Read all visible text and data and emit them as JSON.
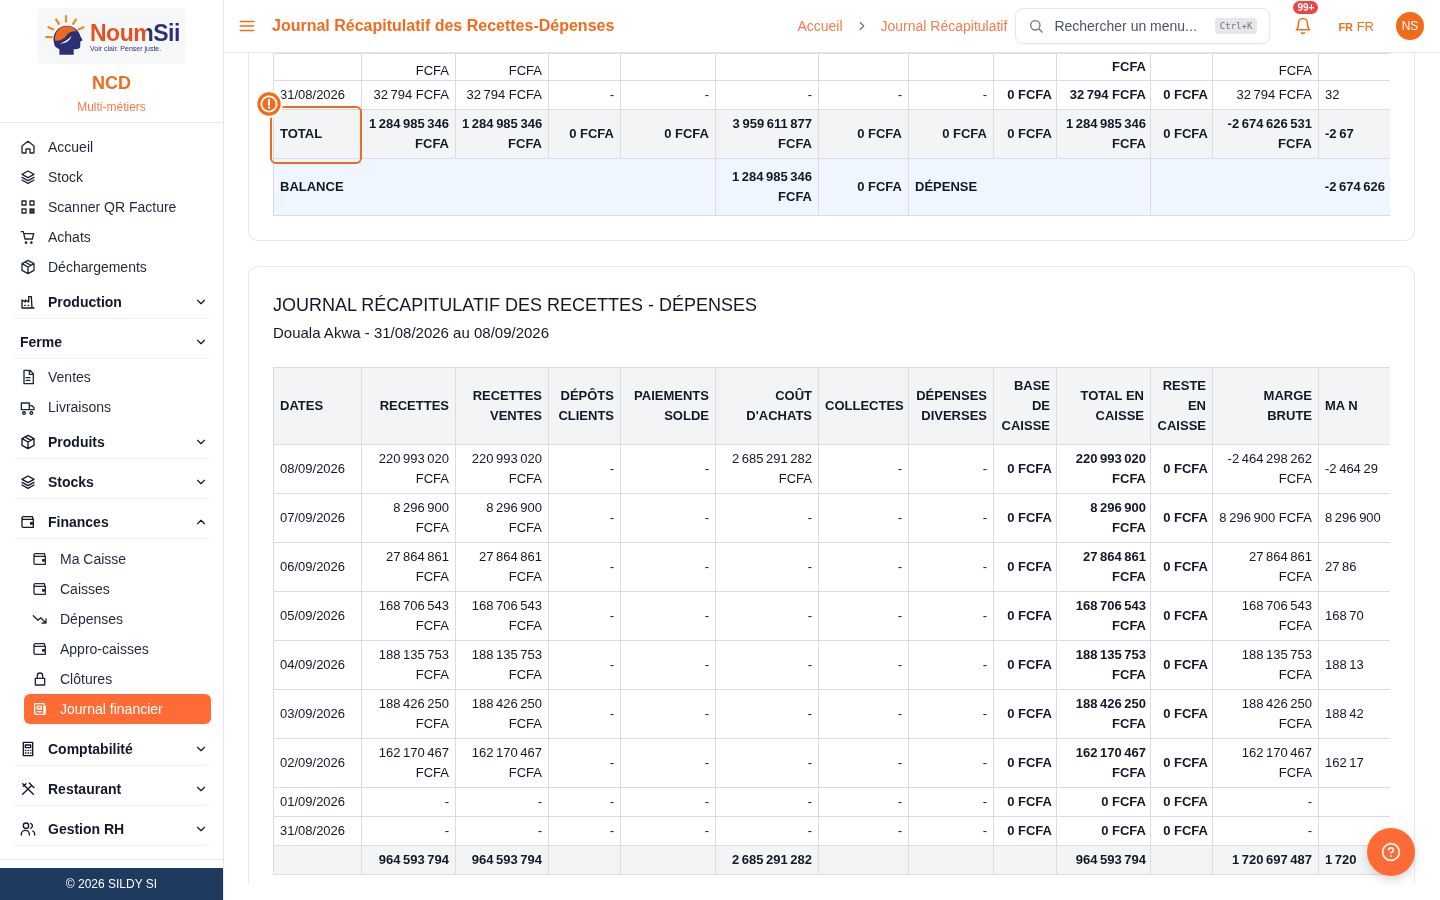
{
  "header": {
    "title": "Journal Récapitulatif des Recettes-Dépenses",
    "breadcrumbs": [
      "Accueil",
      "Journal Récapitulatif"
    ],
    "search": {
      "placeholder": "Rechercher un menu...",
      "shortcut": "Ctrl+K"
    },
    "notifications": "99+",
    "language": {
      "flag": "FR",
      "code": "FR"
    },
    "avatar": "NS"
  },
  "sidebar": {
    "brand": {
      "logo_name": "NoumSii",
      "logo_tagline": "Voir clair. Penser juste.",
      "company": "NCD",
      "subtitle": "Multi-métiers"
    },
    "items": [
      {
        "kind": "link",
        "label": "Accueil",
        "selected": false
      },
      {
        "kind": "link",
        "label": "Stock",
        "selected": false
      },
      {
        "kind": "link",
        "label": "Scanner QR Facture",
        "selected": false
      },
      {
        "kind": "link",
        "label": "Achats",
        "selected": false
      },
      {
        "kind": "link",
        "label": "Déchargements",
        "selected": false
      },
      {
        "kind": "group",
        "label": "Production",
        "expanded": false,
        "selected": false
      },
      {
        "kind": "section",
        "label": "Ferme",
        "expanded": false,
        "selected": false
      },
      {
        "kind": "link",
        "label": "Ventes",
        "selected": false
      },
      {
        "kind": "link",
        "label": "Livraisons",
        "selected": false
      },
      {
        "kind": "group",
        "label": "Produits",
        "expanded": false,
        "selected": false
      },
      {
        "kind": "group",
        "label": "Stocks",
        "expanded": false,
        "selected": false
      },
      {
        "kind": "group",
        "label": "Finances",
        "expanded": true,
        "selected": false,
        "children": [
          {
            "kind": "link",
            "label": "Ma Caisse",
            "selected": false
          },
          {
            "kind": "link",
            "label": "Caisses",
            "selected": false
          },
          {
            "kind": "link",
            "label": "Dépenses",
            "selected": false
          },
          {
            "kind": "link",
            "label": "Appro-caisses",
            "selected": false
          },
          {
            "kind": "link",
            "label": "Clôtures",
            "selected": false
          },
          {
            "kind": "link",
            "label": "Journal financier",
            "selected": true
          }
        ]
      },
      {
        "kind": "group",
        "label": "Comptabilité",
        "expanded": false,
        "selected": false
      },
      {
        "kind": "group",
        "label": "Restaurant",
        "expanded": false,
        "selected": false
      },
      {
        "kind": "group",
        "label": "Gestion RH",
        "expanded": false,
        "selected": false
      }
    ],
    "footer": "© 2026 SILDY SI"
  },
  "summary_table": {
    "rows": [
      {
        "kind": "partial",
        "cells": [
          null,
          "FCFA",
          "FCFA",
          null,
          null,
          null,
          null,
          null,
          null,
          "FCFA",
          null,
          "FCFA",
          null
        ]
      },
      {
        "kind": "data",
        "cells": [
          "31/08/2026",
          "32 794 FCFA",
          "32 794 FCFA",
          "-",
          "-",
          "-",
          "-",
          "-",
          "0 FCFA",
          "32 794 FCFA",
          "0 FCFA",
          "32 794 FCFA",
          "32"
        ]
      },
      {
        "kind": "total",
        "spotlight": true,
        "cells": [
          "TOTAL",
          "1 284 985 346 FCFA",
          "1 284 985 346 FCFA",
          "0 FCFA",
          "0 FCFA",
          "3 959 611 877 FCFA",
          "0 FCFA",
          "0 FCFA",
          "0 FCFA",
          "1 284 985 346 FCFA",
          "0 FCFA",
          "-2 674 626 531 FCFA",
          "-2 67"
        ]
      },
      {
        "kind": "balance",
        "cells": [
          {
            "text": "BALANCE",
            "colspan": 5
          },
          {
            "text": "1 284 985 346 FCFA"
          },
          {
            "text": "0 FCFA"
          },
          {
            "text": "DÉPENSE",
            "colspan": 3
          },
          {
            "text": "-2 674 626",
            "colspan": 3
          }
        ]
      }
    ]
  },
  "report": {
    "title": "JOURNAL RÉCAPITULATIF DES RECETTES - DÉPENSES",
    "subtitle": "Douala Akwa - 31/08/2026 au 08/09/2026",
    "columns": [
      {
        "label": "DATES",
        "strong": false
      },
      {
        "label": "RECETTES",
        "strong": false
      },
      {
        "label": "RECETTES VENTES",
        "strong": false
      },
      {
        "label": "DÉPÔTS CLIENTS",
        "strong": false
      },
      {
        "label": "PAIEMENTS SOLDE",
        "strong": false
      },
      {
        "label": "COÛT D'ACHATS",
        "strong": false
      },
      {
        "label": "COLLECTES",
        "strong": false
      },
      {
        "label": "DÉPENSES DIVERSES",
        "strong": false
      },
      {
        "label": "BASE DE CAISSE",
        "strong": true
      },
      {
        "label": "TOTAL EN CAISSE",
        "strong": true
      },
      {
        "label": "RESTE EN CAISSE",
        "strong": true
      },
      {
        "label": "MARGE BRUTE",
        "strong": false
      },
      {
        "label": "MA\nN",
        "strong": false
      }
    ],
    "rows": [
      {
        "kind": "data",
        "cells": [
          "08/09/2026",
          "220 993 020 FCFA",
          "220 993 020 FCFA",
          "-",
          "-",
          "2 685 291 282 FCFA",
          "-",
          "-",
          "0 FCFA",
          "220 993 020 FCFA",
          "0 FCFA",
          "-2 464 298 262 FCFA",
          "-2 464 29"
        ]
      },
      {
        "kind": "data",
        "cells": [
          "07/09/2026",
          "8 296 900 FCFA",
          "8 296 900 FCFA",
          "-",
          "-",
          "-",
          "-",
          "-",
          "0 FCFA",
          "8 296 900 FCFA",
          "0 FCFA",
          "8 296 900 FCFA",
          "8 296 900"
        ]
      },
      {
        "kind": "data",
        "cells": [
          "06/09/2026",
          "27 864 861 FCFA",
          "27 864 861 FCFA",
          "-",
          "-",
          "-",
          "-",
          "-",
          "0 FCFA",
          "27 864 861 FCFA",
          "0 FCFA",
          "27 864 861 FCFA",
          "27 86"
        ]
      },
      {
        "kind": "data",
        "cells": [
          "05/09/2026",
          "168 706 543 FCFA",
          "168 706 543 FCFA",
          "-",
          "-",
          "-",
          "-",
          "-",
          "0 FCFA",
          "168 706 543 FCFA",
          "0 FCFA",
          "168 706 543 FCFA",
          "168 70"
        ]
      },
      {
        "kind": "data",
        "cells": [
          "04/09/2026",
          "188 135 753 FCFA",
          "188 135 753 FCFA",
          "-",
          "-",
          "-",
          "-",
          "-",
          "0 FCFA",
          "188 135 753 FCFA",
          "0 FCFA",
          "188 135 753 FCFA",
          "188 13"
        ]
      },
      {
        "kind": "data",
        "cells": [
          "03/09/2026",
          "188 426 250 FCFA",
          "188 426 250 FCFA",
          "-",
          "-",
          "-",
          "-",
          "-",
          "0 FCFA",
          "188 426 250 FCFA",
          "0 FCFA",
          "188 426 250 FCFA",
          "188 42"
        ]
      },
      {
        "kind": "data",
        "cells": [
          "02/09/2026",
          "162 170 467 FCFA",
          "162 170 467 FCFA",
          "-",
          "-",
          "-",
          "-",
          "-",
          "0 FCFA",
          "162 170 467 FCFA",
          "0 FCFA",
          "162 170 467 FCFA",
          "162 17"
        ]
      },
      {
        "kind": "data",
        "cells": [
          "01/09/2026",
          "-",
          "-",
          "-",
          "-",
          "-",
          "-",
          "-",
          "0 FCFA",
          "0 FCFA",
          "0 FCFA",
          "-",
          null
        ]
      },
      {
        "kind": "data",
        "cells": [
          "31/08/2026",
          "-",
          "-",
          "-",
          "-",
          "-",
          "-",
          "-",
          "0 FCFA",
          "0 FCFA",
          "0 FCFA",
          "-",
          null
        ]
      },
      {
        "kind": "total",
        "cells": [
          null,
          "964 593 794",
          "964 593 794",
          null,
          null,
          "2 685 291 282",
          null,
          null,
          null,
          "964 593 794",
          null,
          "1 720 697 487",
          "1 720"
        ]
      }
    ]
  }
}
